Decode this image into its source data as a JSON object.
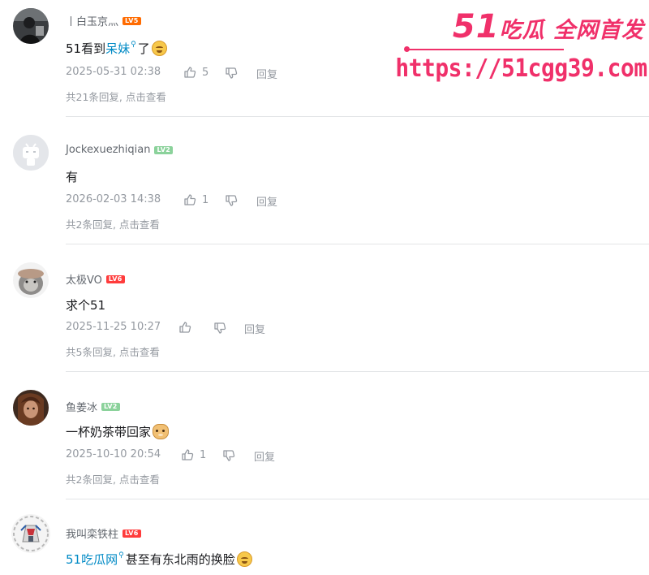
{
  "comments": [
    {
      "username": "丨白玉京灬",
      "level": "LV5",
      "level_color": "#ff6b00",
      "content_prefix": "51看到",
      "content_link": "呆妹",
      "content_suffix": "了",
      "content_emoji": "laugh-emoji",
      "time": "2025-05-31 02:38",
      "likes": "5",
      "reply_label": "回复",
      "replies_info": "共21条回复, 点击查看"
    },
    {
      "username": "Jockexuezhiqian",
      "level": "LV2",
      "level_color": "#8bd29b",
      "content": "有",
      "time": "2026-02-03 14:38",
      "likes": "1",
      "reply_label": "回复",
      "replies_info": "共2条回复, 点击查看"
    },
    {
      "username": "太极VO",
      "level": "LV6",
      "level_color": "#ff3c3c",
      "content": "求个51",
      "time": "2025-11-25 10:27",
      "likes": "",
      "reply_label": "回复",
      "replies_info": "共5条回复, 点击查看"
    },
    {
      "username": "鱼姜冰",
      "level": "LV2",
      "level_color": "#8bd29b",
      "content": "一杯奶茶带回家",
      "content_emoji": "doge-emoji",
      "time": "2025-10-10 20:54",
      "likes": "1",
      "reply_label": "回复",
      "replies_info": "共2条回复, 点击查看"
    },
    {
      "username": "我叫栾铁柱",
      "level": "LV6",
      "level_color": "#ff3c3c",
      "content_link": "51吃瓜网",
      "content_suffix": "甚至有东北雨的换脸",
      "content_emoji": "laugh-emoji"
    }
  ],
  "watermark": {
    "brand_number": "51",
    "brand_text": "吃瓜 全网首发",
    "url": "https://51cgg39.com",
    "color": "#f0306a"
  },
  "icons": {
    "like": "thumbs-up-icon",
    "dislike": "thumbs-down-icon",
    "search_link": "search-link-icon"
  }
}
